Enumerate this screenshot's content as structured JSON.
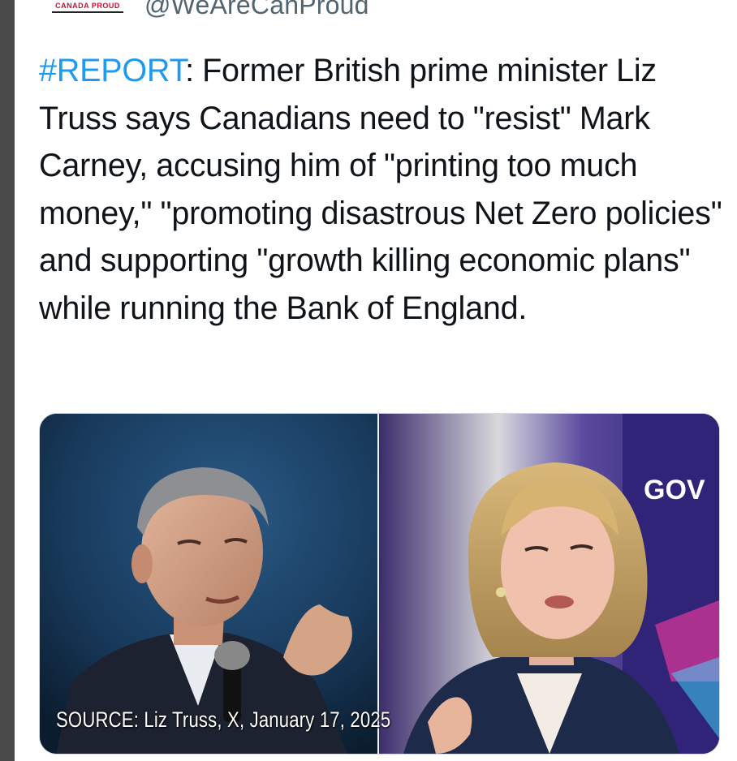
{
  "header": {
    "logo_text": "CANADA PROUD",
    "handle": "@WeAreCanProud"
  },
  "tweet": {
    "hashtag": "#REPORT",
    "body": ": Former British prime minister Liz Truss says Canadians need to \"resist\" Mark Carney, accusing him of \"printing too much money,\" \"promoting disastrous Net Zero policies\" and supporting \"growth killing economic plans\" while running the Bank of England."
  },
  "media": {
    "caption": "SOURCE: Liz Truss, X, January 17, 2025",
    "backdrop_text": "GOV"
  },
  "colors": {
    "hashtag": "#1d9bf0",
    "text": "#0f1419",
    "handle": "#536471"
  }
}
